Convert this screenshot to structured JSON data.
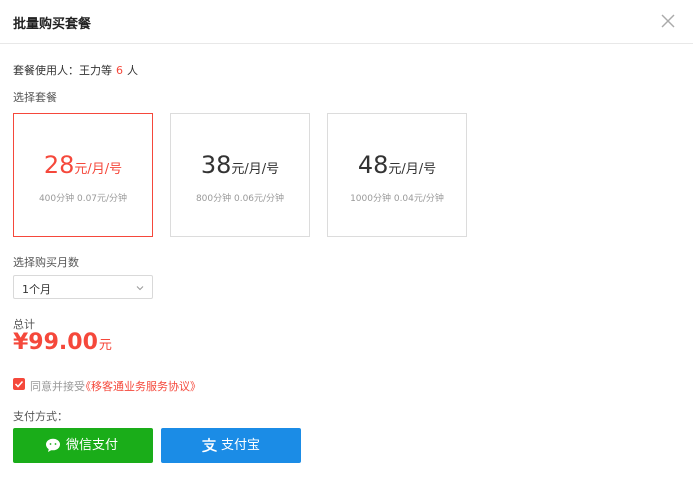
{
  "dialog": {
    "title": "批量购买套餐",
    "close_icon": "close-icon"
  },
  "users": {
    "label": "套餐使用人：",
    "names": "王力等",
    "count": "6",
    "suffix": "人"
  },
  "plans": {
    "label": "选择套餐",
    "items": [
      {
        "price": "28",
        "unit": "元/月/号",
        "desc": "400分钟  0.07元/分钟",
        "selected": true
      },
      {
        "price": "38",
        "unit": "元/月/号",
        "desc": "800分钟 0.06元/分钟",
        "selected": false
      },
      {
        "price": "48",
        "unit": "元/月/号",
        "desc": "1000分钟 0.04元/分钟",
        "selected": false
      }
    ]
  },
  "months": {
    "label": "选择购买月数",
    "selected": "1个月"
  },
  "total": {
    "label": "总计",
    "amount": "¥99.00",
    "unit": "元"
  },
  "agreement": {
    "checked": true,
    "text": "同意并接受",
    "link": "《移客通业务服务协议》"
  },
  "payment": {
    "label": "支付方式：",
    "wechat": "微信支付",
    "alipay": "支付宝"
  },
  "colors": {
    "accent": "#f5483b",
    "wechat": "#1aad19",
    "alipay": "#1b8ce6"
  }
}
